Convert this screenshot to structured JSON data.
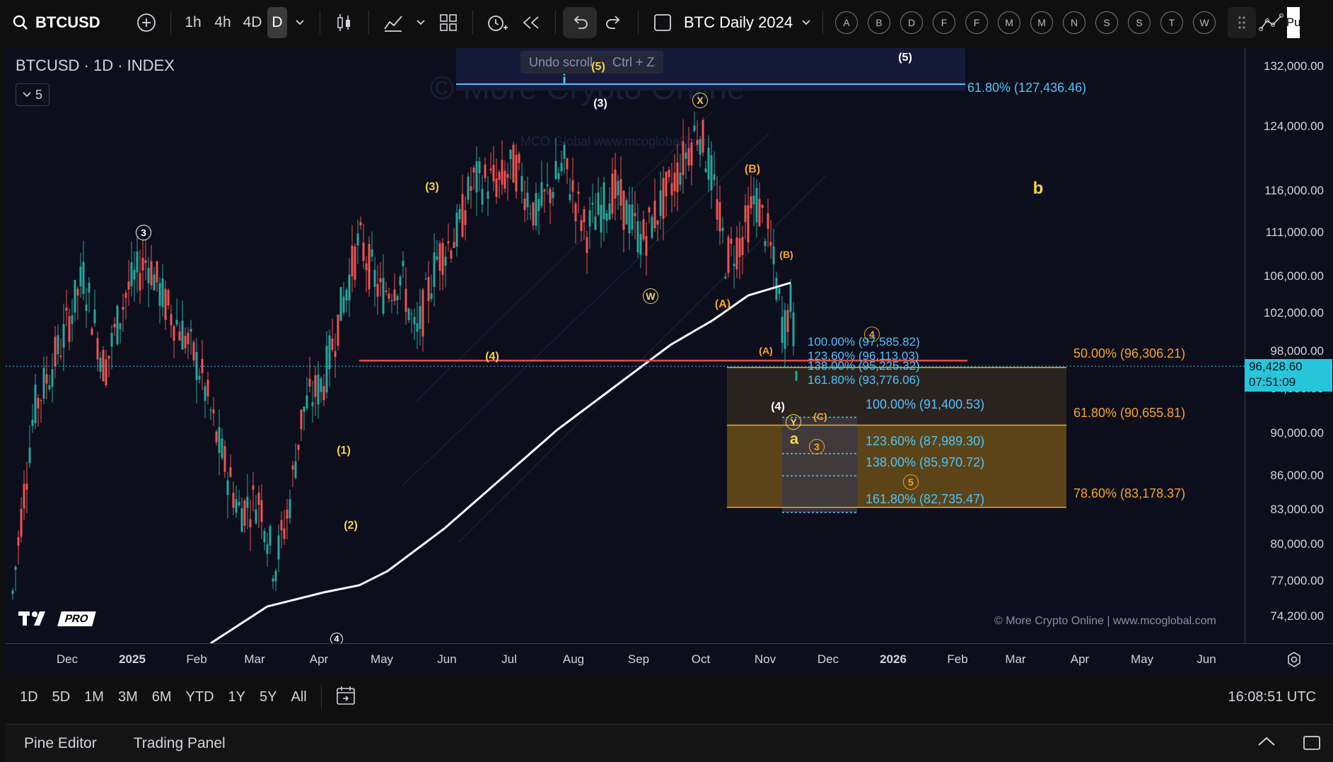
{
  "topbar": {
    "symbol": "BTCUSD",
    "timeframes": [
      "1h",
      "4h",
      "4D",
      "D"
    ],
    "active_timeframe": "D",
    "layout_name": "BTC Daily 2024",
    "alphabet_buttons": [
      "A",
      "B",
      "D",
      "F",
      "F",
      "M",
      "M",
      "N",
      "S",
      "S",
      "T",
      "W"
    ],
    "publish_partial": "Pu"
  },
  "tooltip": {
    "label": "Undo scroll",
    "shortcut": "Ctrl + Z"
  },
  "legend": {
    "title": "BTCUSD · 1D · INDEX",
    "collapse_count": "5"
  },
  "watermark": {
    "main": "© More Crypto Online",
    "sub": "MCO Global    www.mcoglobal.com"
  },
  "price_axis": {
    "ticks": [
      "132,000.00",
      "124,000.00",
      "116,000.00",
      "111,000.00",
      "106,000.00",
      "102,000.00",
      "98,000.00",
      "94,000.00",
      "90,000.00",
      "86,000.00",
      "83,000.00",
      "80,000.00",
      "77,000.00",
      "74,200.00"
    ],
    "current_price": "96,428.60",
    "countdown": "07:51:09"
  },
  "time_axis": {
    "ticks": [
      "Dec",
      "2025",
      "Feb",
      "Mar",
      "Apr",
      "May",
      "Jun",
      "Jul",
      "Aug",
      "Sep",
      "Oct",
      "Nov",
      "Dec",
      "2026",
      "Feb",
      "Mar",
      "Apr",
      "May",
      "Jun"
    ]
  },
  "fib_levels": {
    "upper": "61.80% (127,436.46)",
    "cyan_set_1": [
      "100.00% (97,585.82)",
      "123.60% (96,113.03)",
      "138.00% (95,225.32)",
      "161.80% (93,776.06)"
    ],
    "cyan_set_2": [
      "100.00% (91,400.53)",
      "123.60% (87,989.30)",
      "138.00% (85,970.72)",
      "161.80% (82,735.47)"
    ],
    "orange_set": [
      "50.00% (96,306.21)",
      "61.80% (90,655.81)",
      "78.60% (83,178.37)"
    ]
  },
  "wave_labels": [
    "(5)",
    "(5)",
    "i",
    "(3)",
    "X",
    "(3)",
    "3",
    "W",
    "(B)",
    "(A)",
    "(B)",
    "(A)",
    "(4)",
    "4",
    "(4)",
    "(C)",
    "Y",
    "a",
    "3",
    "5",
    "b",
    "(1)",
    "(2)",
    "4"
  ],
  "bottom": {
    "ranges": [
      "1D",
      "5D",
      "1M",
      "3M",
      "6M",
      "YTD",
      "1Y",
      "5Y",
      "All"
    ],
    "time_utc": "16:08:51 UTC"
  },
  "footer": {
    "tabs": [
      "Pine Editor",
      "Trading Panel"
    ]
  },
  "branding": {
    "pro_badge": "PRO",
    "copyright": "© More Crypto Online  |  www.mcoglobal.com"
  },
  "colors": {
    "background": "#0c0e1c",
    "up_candle": "#26a69a",
    "down_candle": "#ef5350",
    "accent_cyan": "#4fc3f7",
    "accent_orange": "#f5a623",
    "ma_line": "#ffffff",
    "resistance_line": "#ff4444"
  }
}
